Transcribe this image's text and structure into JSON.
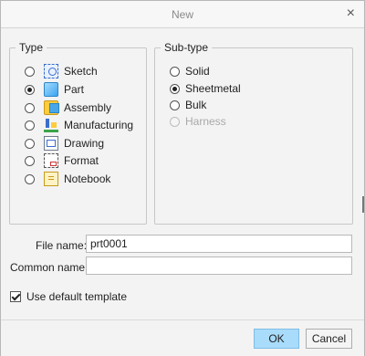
{
  "window": {
    "title": "New",
    "close_icon": "×"
  },
  "type": {
    "legend": "Type",
    "items": [
      {
        "label": "Sketch",
        "icon": "sketch-icon",
        "selected": false
      },
      {
        "label": "Part",
        "icon": "part-icon",
        "selected": true
      },
      {
        "label": "Assembly",
        "icon": "assembly-icon",
        "selected": false
      },
      {
        "label": "Manufacturing",
        "icon": "manufacturing-icon",
        "selected": false
      },
      {
        "label": "Drawing",
        "icon": "drawing-icon",
        "selected": false
      },
      {
        "label": "Format",
        "icon": "format-icon",
        "selected": false
      },
      {
        "label": "Notebook",
        "icon": "notebook-icon",
        "selected": false
      }
    ]
  },
  "subtype": {
    "legend": "Sub-type",
    "items": [
      {
        "label": "Solid",
        "selected": false,
        "disabled": false
      },
      {
        "label": "Sheetmetal",
        "selected": true,
        "disabled": false
      },
      {
        "label": "Bulk",
        "selected": false,
        "disabled": false
      },
      {
        "label": "Harness",
        "selected": false,
        "disabled": true
      }
    ]
  },
  "fields": {
    "file_name_label": "File name:",
    "file_name_value": "prt0001",
    "common_name_label": "Common name:",
    "common_name_value": ""
  },
  "options": {
    "use_default_template_label": "Use default template",
    "use_default_template_checked": true
  },
  "buttons": {
    "ok": "OK",
    "cancel": "Cancel"
  },
  "colors": {
    "ok_button": "#a9dcfb",
    "dialog_bg": "#f3f3f3"
  }
}
